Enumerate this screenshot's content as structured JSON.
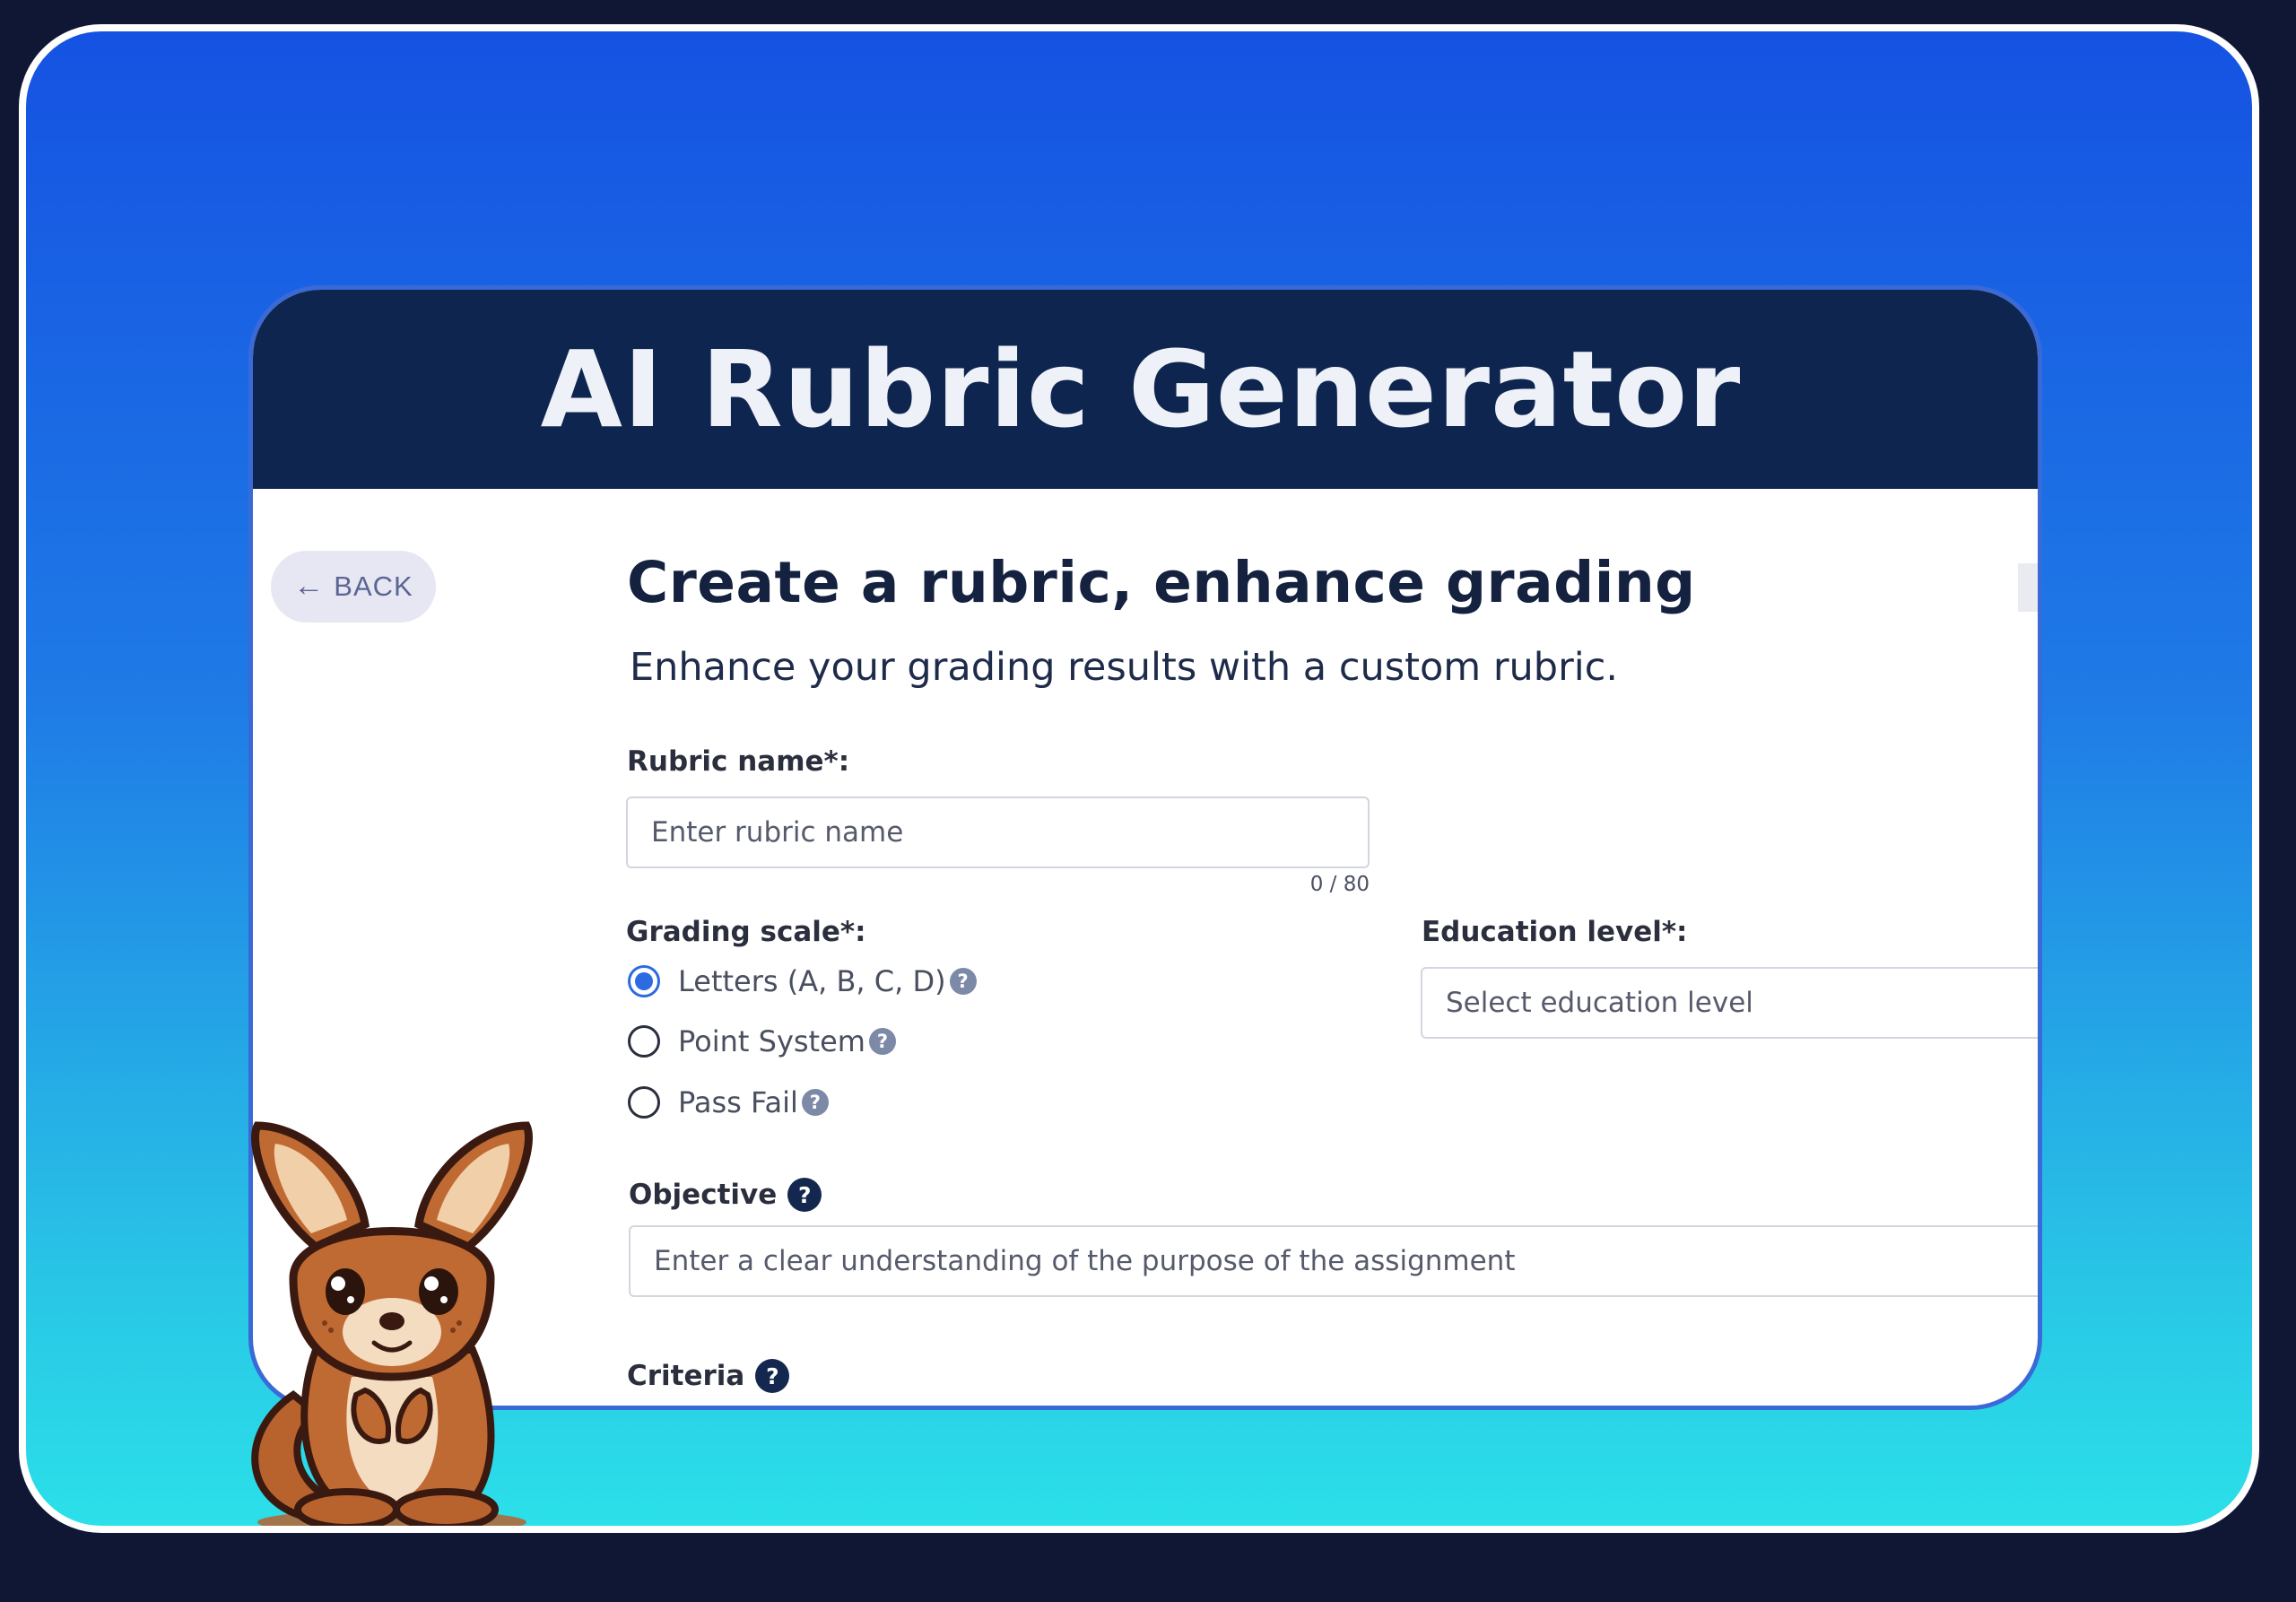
{
  "banner": {
    "title": "AI Rubric Generator"
  },
  "nav": {
    "back_label": "BACK",
    "back_icon": "arrow-left-icon"
  },
  "page": {
    "heading": "Create a rubric, enhance grading",
    "subheading": "Enhance your grading results with a custom rubric."
  },
  "form": {
    "rubric_name": {
      "label": "Rubric name*:",
      "placeholder": "Enter rubric name",
      "value": "",
      "counter": "0 / 80"
    },
    "grading_scale": {
      "label": "Grading scale*:",
      "options": [
        {
          "label": "Letters (A, B, C, D)",
          "checked": true
        },
        {
          "label": "Point System",
          "checked": false
        },
        {
          "label": "Pass Fail",
          "checked": false
        }
      ],
      "help_icon": "question-icon"
    },
    "education_level": {
      "label": "Education level*:",
      "placeholder": "Select education level"
    },
    "objective": {
      "label": "Objective",
      "placeholder": "Enter a clear understanding of the purpose of the assignment"
    },
    "criteria": {
      "label": "Criteria"
    }
  },
  "colors": {
    "background": "#0f1735",
    "gradient_top": "#1552e2",
    "gradient_bottom": "#2be0e8",
    "header_navy": "#0e2550",
    "accent_blue": "#2d6be0"
  },
  "mascot": {
    "icon": "kangaroo-mascot"
  }
}
